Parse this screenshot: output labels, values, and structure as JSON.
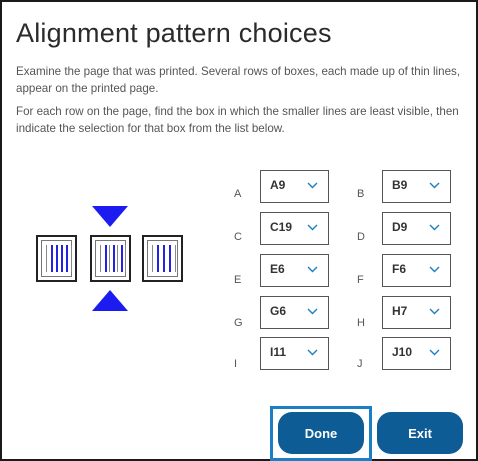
{
  "title": "Alignment pattern choices",
  "instructions": {
    "paragraph1": "Examine the page that was printed. Several rows of boxes, each made up of thin lines, appear on the printed page.",
    "paragraph2": "For each row on the page, find the box in which the smaller lines are least visible, then indicate the selection for that box from the list below."
  },
  "selections": [
    {
      "row": "A",
      "value": "A9"
    },
    {
      "row": "B",
      "value": "B9"
    },
    {
      "row": "C",
      "value": "C19"
    },
    {
      "row": "D",
      "value": "D9"
    },
    {
      "row": "E",
      "value": "E6"
    },
    {
      "row": "F",
      "value": "F6"
    },
    {
      "row": "G",
      "value": "G6"
    },
    {
      "row": "H",
      "value": "H7"
    },
    {
      "row": "I",
      "value": "I11"
    },
    {
      "row": "J",
      "value": "J10"
    }
  ],
  "buttons": {
    "done": "Done",
    "exit": "Exit"
  },
  "colors": {
    "accent": "#0d5c96",
    "focus_ring": "#1a7fc4",
    "pattern_blue": "#1c1cf0"
  }
}
